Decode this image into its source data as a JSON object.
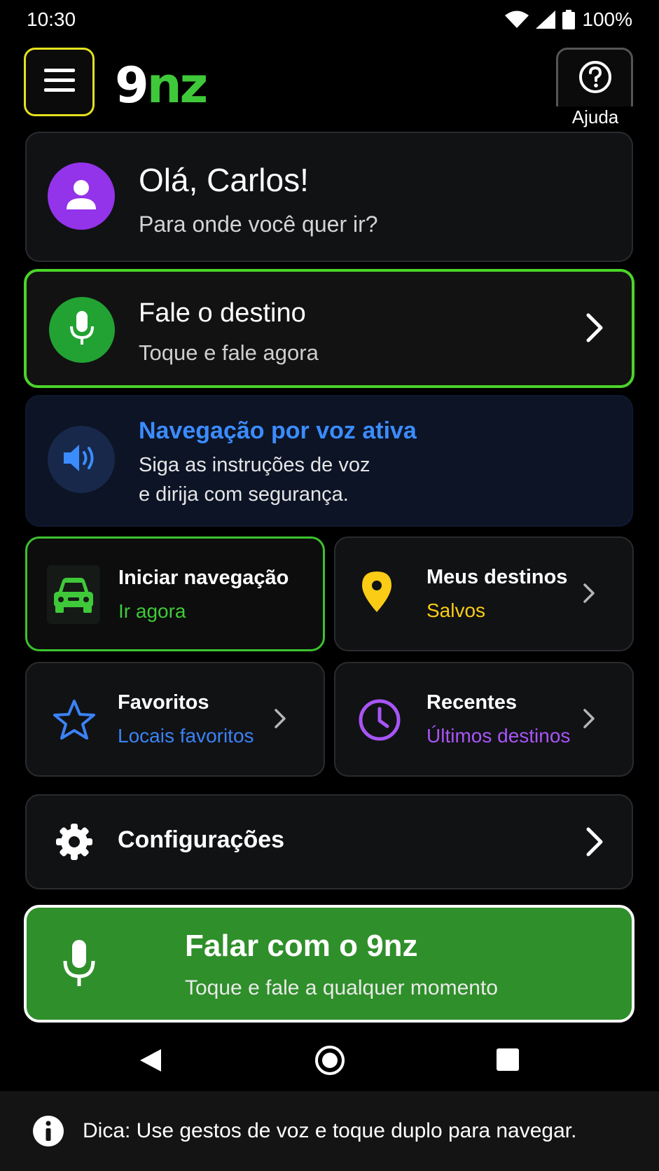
{
  "status_bar": {
    "time": "10:30",
    "battery": "100%",
    "icons": [
      "wifi-icon",
      "signal-icon",
      "battery-icon"
    ]
  },
  "header": {
    "logo_nine": "9",
    "logo_nz": "nz",
    "help_label": "Ajuda"
  },
  "greeting": {
    "title": "Olá, Carlos!",
    "subtitle": "Para onde você quer ir?"
  },
  "voice_destination": {
    "title": "Fale o destino",
    "subtitle": "Toque e fale agora"
  },
  "voice_navigation": {
    "title": "Navegação por voz ativa",
    "line1": "Siga as instruções de voz",
    "line2": "e dirija com segurança."
  },
  "tiles": [
    {
      "title": "Iniciar navegação",
      "subtitle": "Ir agora",
      "icon": "car-icon",
      "color": "#3fc93a"
    },
    {
      "title": "Meus destinos",
      "subtitle": "Salvos",
      "icon": "location-pin-icon",
      "color": "#facc15"
    },
    {
      "title": "Favoritos",
      "subtitle": "Locais favoritos",
      "icon": "star-icon",
      "color": "#3b82f6"
    },
    {
      "title": "Recentes",
      "subtitle": "Últimos destinos",
      "icon": "clock-icon",
      "color": "#a855f7"
    }
  ],
  "settings": {
    "label": "Configurações"
  },
  "talk_button": {
    "title": "Falar com o 9nz",
    "subtitle": "Toque e fale a qualquer momento"
  },
  "tip": {
    "text": "Dica: Use gestos de voz e toque duplo para navegar."
  },
  "colors": {
    "accent_green": "#3fc93a",
    "highlight_yellow": "#e4e11f",
    "voice_blue": "#3b8cff",
    "avatar_purple": "#9333ea"
  }
}
